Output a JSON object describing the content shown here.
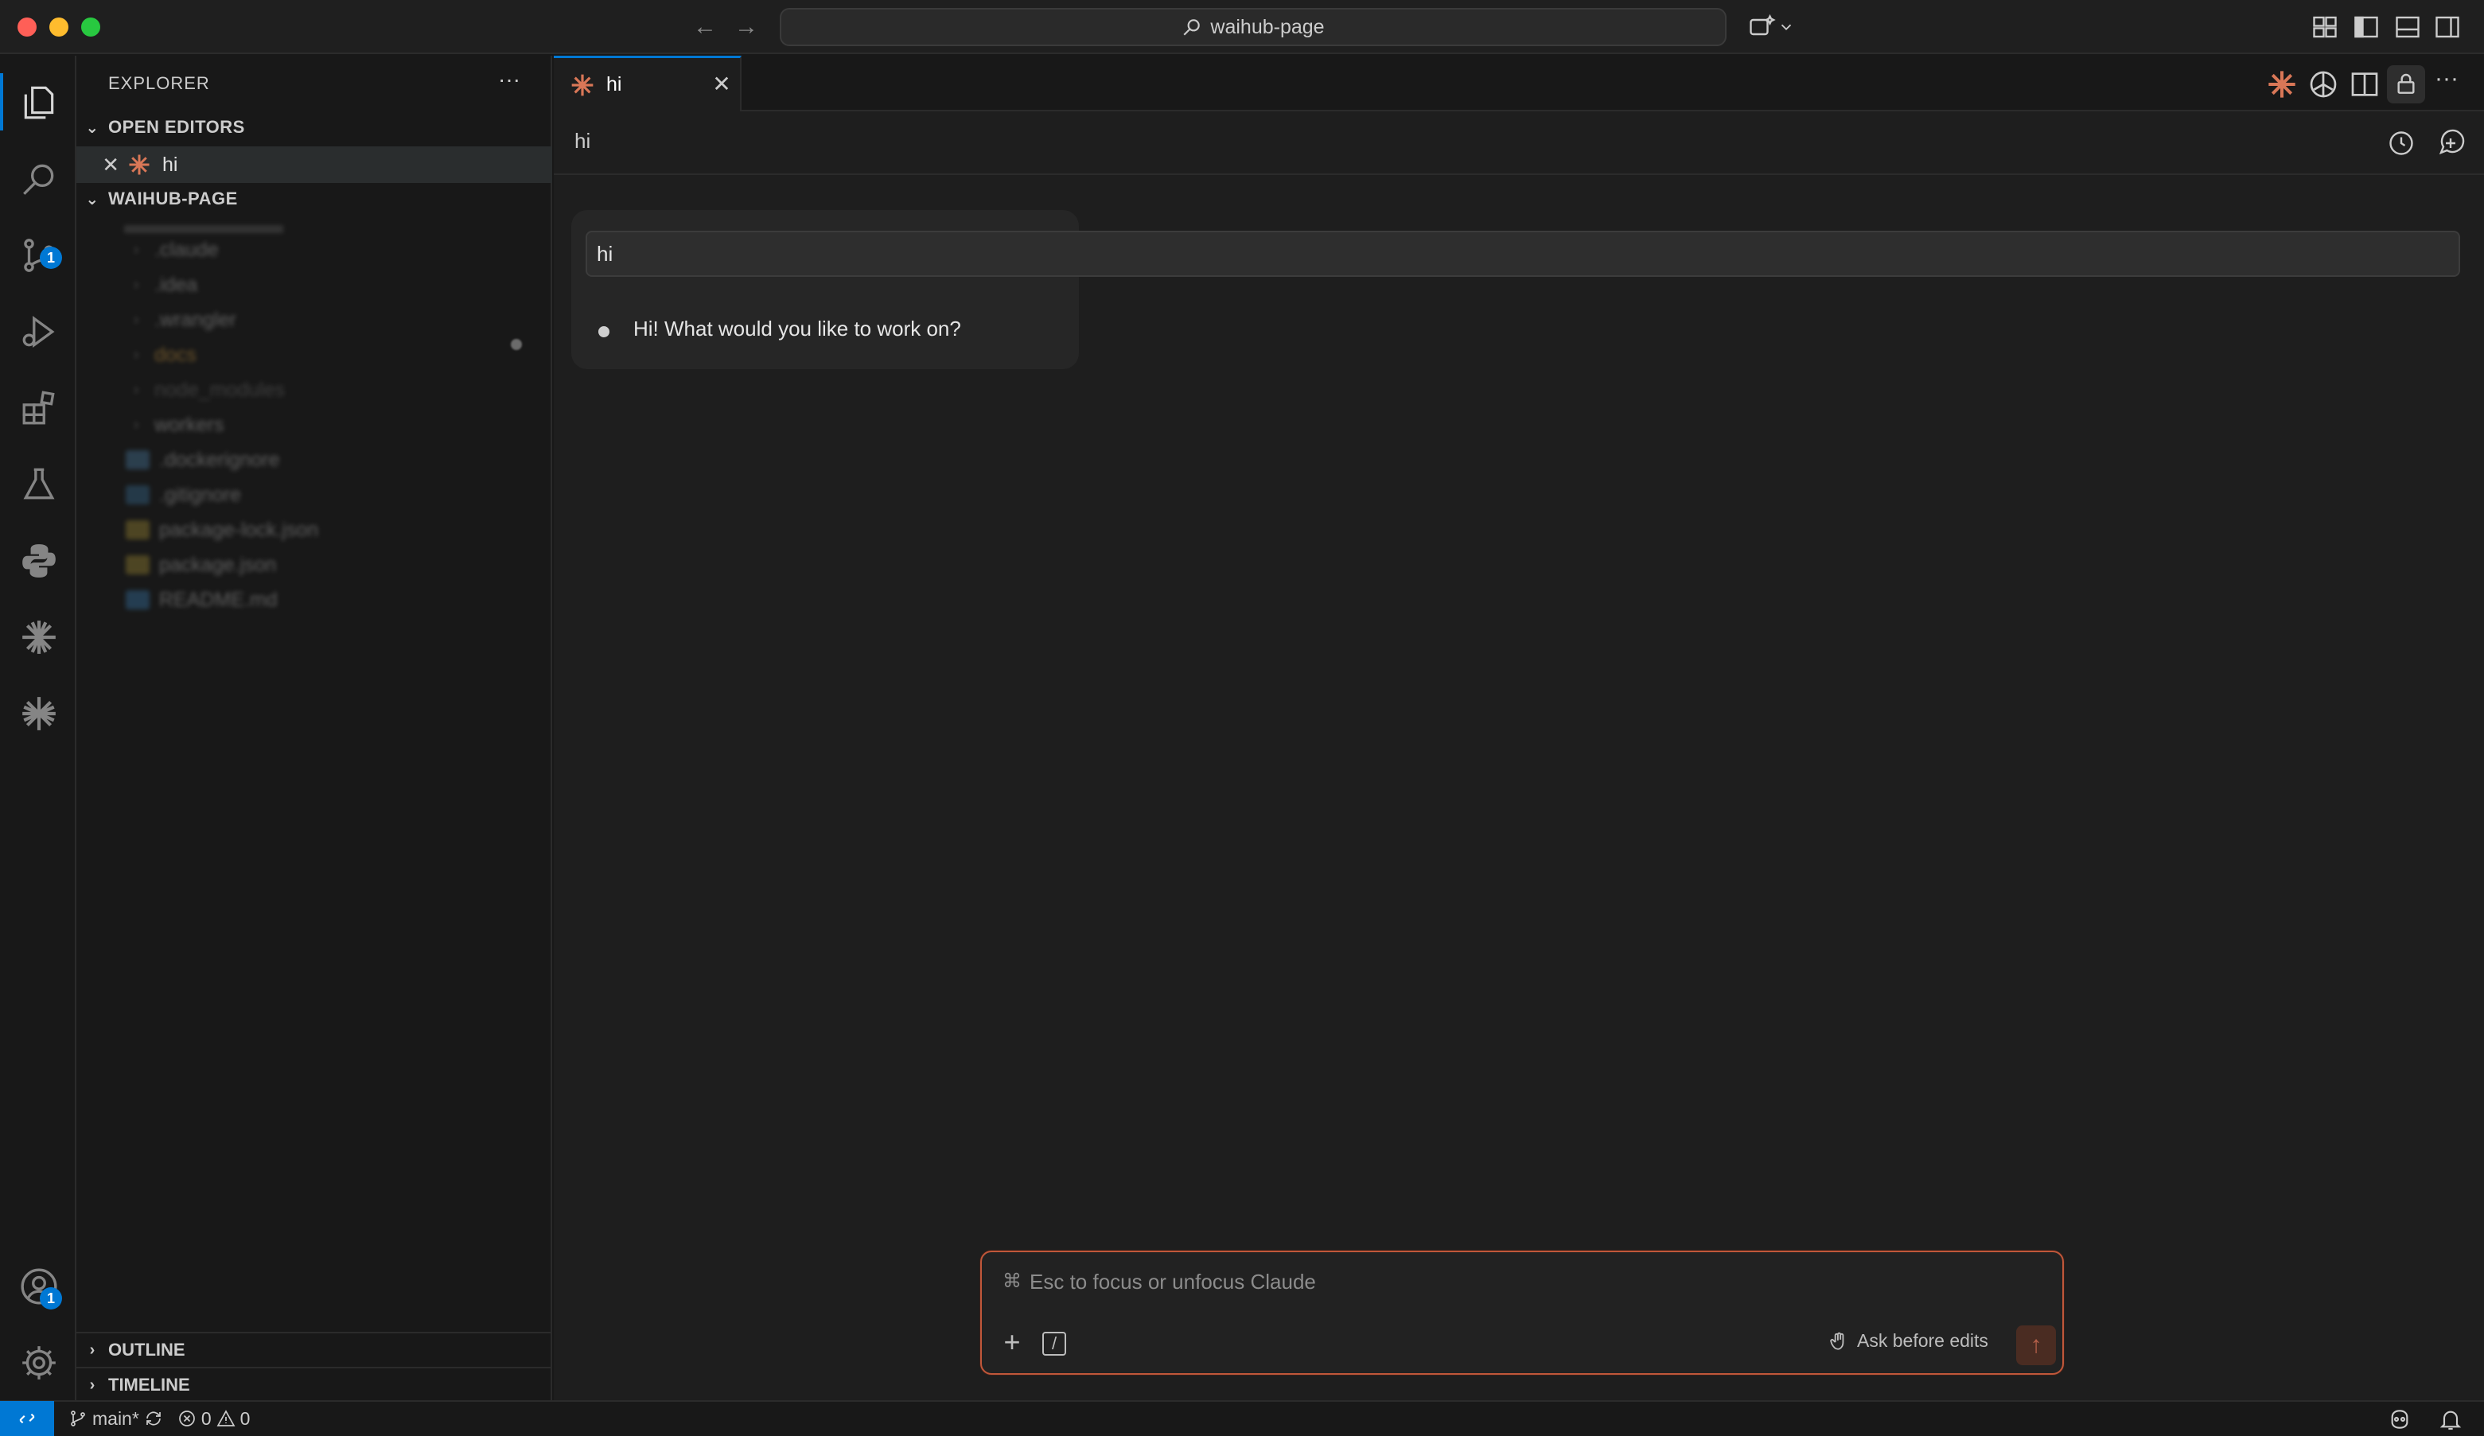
{
  "window": {
    "search": "waihub-page"
  },
  "sidebar": {
    "title": "EXPLORER",
    "open_editors": {
      "header": "OPEN EDITORS",
      "items": [
        {
          "label": "hi"
        }
      ]
    },
    "project": {
      "header": "WAIHUB-PAGE",
      "items": [
        {
          "label": ".claude",
          "kind": "folder"
        },
        {
          "label": ".idea",
          "kind": "folder"
        },
        {
          "label": ".wrangler",
          "kind": "folder"
        },
        {
          "label": "docs",
          "kind": "folder"
        },
        {
          "label": "node_modules",
          "kind": "folder"
        },
        {
          "label": "workers",
          "kind": "folder"
        },
        {
          "label": ".dockerignore",
          "kind": "file"
        },
        {
          "label": ".gitignore",
          "kind": "file"
        },
        {
          "label": "package-lock.json",
          "kind": "file"
        },
        {
          "label": "package.json",
          "kind": "file"
        },
        {
          "label": "README.md",
          "kind": "file"
        }
      ]
    },
    "outline": "OUTLINE",
    "timeline": "TIMELINE"
  },
  "activity": {
    "source_control_badge": "1",
    "accounts_badge": "1"
  },
  "editor": {
    "tab": {
      "label": "hi"
    },
    "chat": {
      "title": "hi",
      "user_message": "hi",
      "assistant_message": "Hi! What would you like to work on?"
    },
    "composer": {
      "placeholder": "Esc to focus or unfocus Claude",
      "mode": "Ask before edits"
    }
  },
  "status": {
    "branch": "main*",
    "errors": "0",
    "warnings": "0"
  },
  "colors": {
    "accent": "#0078d4",
    "claude": "#d97757",
    "composer_border": "#c0573a"
  }
}
